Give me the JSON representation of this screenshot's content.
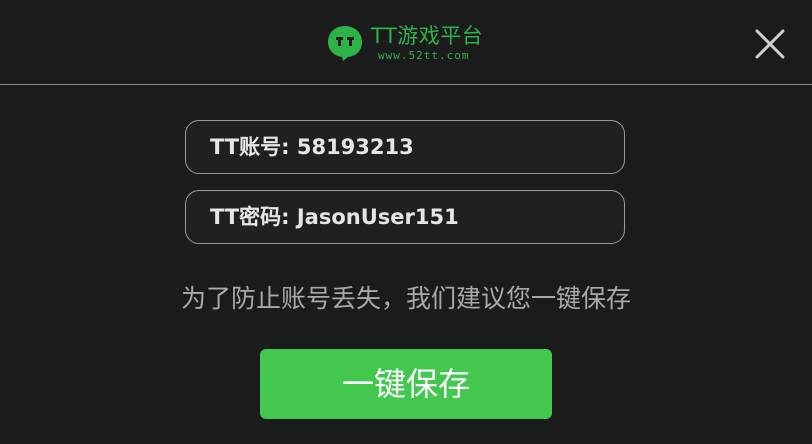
{
  "header": {
    "logo_title": "TT游戏平台",
    "logo_url": "www.52tt.com",
    "close_icon": "close-icon"
  },
  "fields": {
    "account_label": "TT账号:",
    "account_value": "58193213",
    "password_label": "TT密码:",
    "password_value": "JasonUser151"
  },
  "hint": "为了防止账号丢失，我们建议您一键保存",
  "save_button": "一键保存",
  "colors": {
    "brand_green": "#2bb34a",
    "button_green": "#43c74f",
    "background": "#1b1b1b"
  }
}
